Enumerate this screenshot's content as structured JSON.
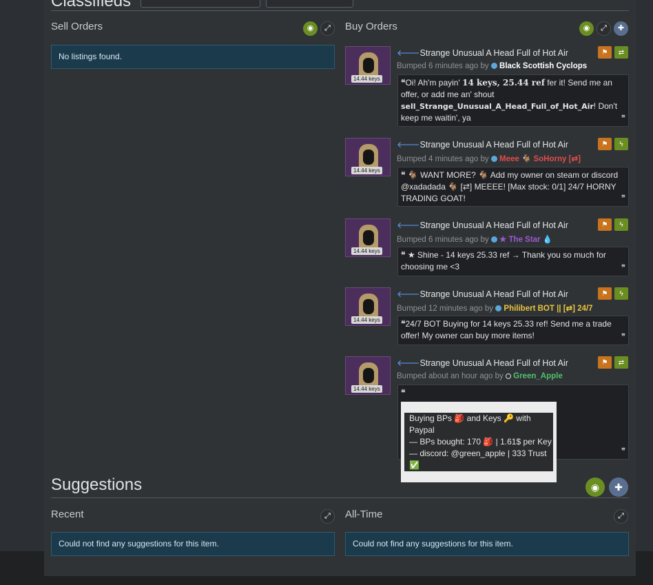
{
  "header": {
    "section_title": "Classifieds"
  },
  "sell_orders": {
    "title": "Sell Orders",
    "empty_text": "No listings found."
  },
  "buy_orders": {
    "title": "Buy Orders",
    "listings": [
      {
        "price": "14.44 keys",
        "item": "Strange Unusual A Head Full of Hot Air",
        "bumped": "Bumped 6 minutes ago by ",
        "user": "Black Scottish Cyclops",
        "action": "trade",
        "comment_a": "Oi! Ah'm payin' ",
        "comment_b": "14 keys, 25.44 ref",
        "comment_c": " fer it! Send me an offer, or add me an' shout ",
        "comment_d": "sell_Strange_Unusual_A_Head_Full_of_Hot_Air",
        "comment_e": "! Don't keep me waitin', ya"
      },
      {
        "price": "14.44 keys",
        "item": "Strange Unusual A Head Full of Hot Air",
        "bumped": "Bumped 4 minutes ago by ",
        "user": "Meee 🐐 SoHorny [⇄]",
        "action": "instant",
        "comment": "🐐 WANT MORE? 🐐 Add my owner on steam or discord @xadadada 🐐 [⇄] MEEEE! [Max stock: 0/1] 24/7 HORNY TRADING GOAT!"
      },
      {
        "price": "14.44 keys",
        "item": "Strange Unusual A Head Full of Hot Air",
        "bumped": "Bumped 6 minutes ago by ",
        "user": "★ The Star 💧",
        "action": "instant",
        "comment": "★ Shine - 14 keys 25.33 ref → Thank you so much for choosing me <3"
      },
      {
        "price": "14.44 keys",
        "item": "Strange Unusual A Head Full of Hot Air",
        "bumped": "Bumped 12 minutes ago by ",
        "user": "Philibert BOT || [⇄] 24/7",
        "action": "instant",
        "comment": "24/7 BOT Buying for 14 keys 25.33 ref! Send me a trade offer! My owner can buy more items!"
      },
      {
        "price": "14.44 keys",
        "item": "Strange Unusual A Head Full of Hot Air",
        "bumped": "Bumped about an hour ago by ",
        "user": "Green_Apple",
        "action": "trade",
        "comment_lines": [
          "Buying BPs 🎒 and Keys 🔑 with Paypal",
          "— BPs bought: 170 🎒 | 1.61$ per Key",
          "— discord: @green_apple | 333 Trust ✅"
        ]
      }
    ]
  },
  "suggestions": {
    "title": "Suggestions",
    "recent": {
      "title": "Recent",
      "empty_text": "Could not find any suggestions for this item."
    },
    "alltime": {
      "title": "All-Time",
      "empty_text": "Could not find any suggestions for this item."
    }
  },
  "colors": {
    "accent_blue": "#1b3a4c",
    "orange": "#c8731e",
    "green": "#6b8e23"
  }
}
